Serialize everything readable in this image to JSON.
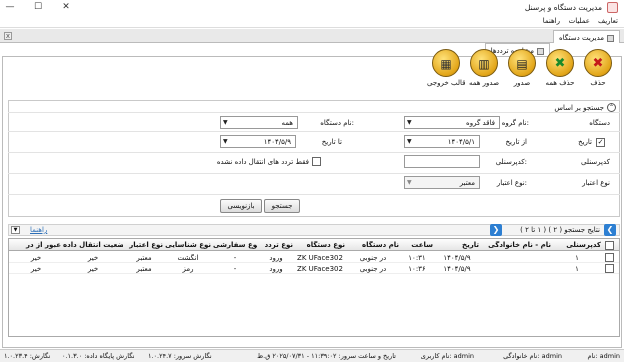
{
  "window": {
    "title": "مدیریت دستگاه و پرسنل"
  },
  "menu": {
    "items": [
      "تعاریف",
      "عملیات",
      "راهنما"
    ]
  },
  "outer_tabs": {
    "active": "مدیریت دستگاه",
    "close": "x"
  },
  "inner_tabs": {
    "active": "مشاهده ترددها"
  },
  "toolbar": {
    "delete": "حذف",
    "delete_all": "حذف همه",
    "export": "صدور",
    "export_all": "صدور همه",
    "output_template": "قالب خروجی"
  },
  "search": {
    "header": "جستجو بر اساس",
    "device_label": "دستگاه",
    "group_name_label": "نام گروه:",
    "group_name_value": "فاقد گروه",
    "device_name_label": "نام دستگاه:",
    "device_name_value": "همه",
    "date_label": "تاریخ",
    "from_date_label": "از تاریخ",
    "from_date_value": "۱۴۰۴/۵/۱",
    "to_date_label": "تا تاریخ",
    "to_date_value": "۱۴۰۴/۵/۹",
    "personnel_label": "کدپرسنلی",
    "personnel_code_label": "کدپرسنلی:",
    "only_untransferred_label": "فقط تردد های انتقال داده نشده",
    "validity_label": "نوع اعتبار",
    "validity_type_label": "نوع اعتبار:",
    "validity_value": "معتبر",
    "search_button": "جستجو",
    "reset_button": "بازنویسی"
  },
  "results": {
    "summary": "نتایج جستجو ( ۲ ) ( ۱ تا ۲ )",
    "help_link": "راهنما"
  },
  "grid": {
    "columns": [
      "کدپرسنلی",
      "نام - نام خانوادگی",
      "تاریخ",
      "ساعت",
      "نام دستگاه",
      "نوع دستگاه",
      "نوع تردد",
      "نوع سفارشی",
      "نوع شناسایی",
      "نوع اعتبار",
      "وضعیت انتقال داده",
      "عبور از در"
    ],
    "rows": [
      [
        "۱",
        "",
        "۱۴۰۴/۵/۹",
        "۱۰:۳۱",
        "در جنوبی",
        "ZK UFace302",
        "ورود",
        "-",
        "انگشت",
        "معتبر",
        "خیر",
        "خیر"
      ],
      [
        "۱",
        "",
        "۱۴۰۴/۵/۹",
        "۱۰:۳۶",
        "در جنوبی",
        "ZK UFace302",
        "ورود",
        "-",
        "رمز",
        "معتبر",
        "خیر",
        "خیر"
      ]
    ]
  },
  "status": {
    "name": "نام: admin",
    "family": "نام خانوادگی: admin",
    "username": "نام کاربری: admin",
    "server_datetime": "تاریخ و ساعت سرور: ۱۱:۳۹:۰۲ - ۲۰۲۵/۰۷/۳۱ ق.ظ",
    "server_version": "نگارش سرور: ۱.۰.۲۴.۷",
    "db_version": "نگارش پایگاه داده: ۰.۱.۳.۰",
    "app_version": "نگارش: ۱.۰.۲۳.۴"
  }
}
